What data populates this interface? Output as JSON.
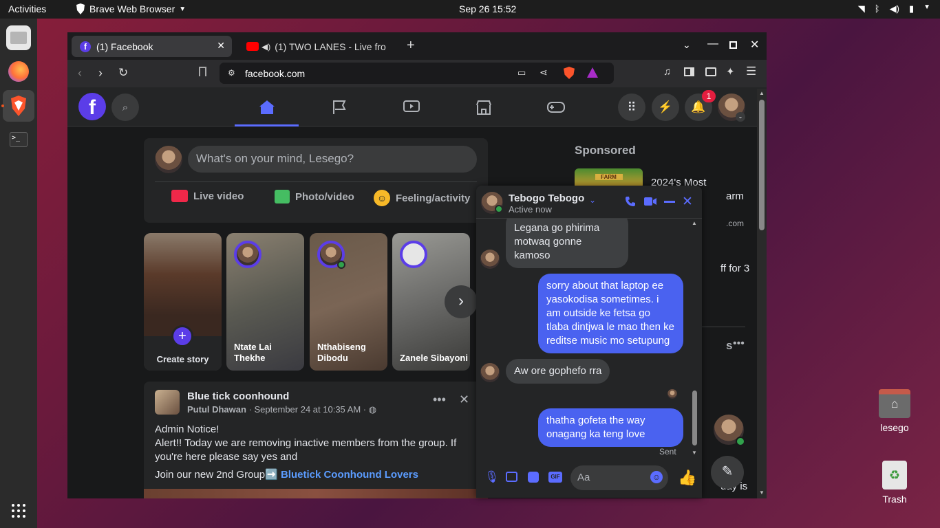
{
  "system": {
    "activities": "Activities",
    "app_name": "Brave Web Browser",
    "clock": "Sep 26  15:52"
  },
  "desktop": {
    "home_label": "lesego",
    "trash_label": "Trash"
  },
  "browser": {
    "tabs": [
      {
        "title": "(1) Facebook"
      },
      {
        "title": "(1) TWO LANES - Live fro"
      }
    ],
    "url": "facebook.com"
  },
  "fb": {
    "notification_count": "1",
    "composer_placeholder": "What's on your mind, Lesego?",
    "composer_actions": [
      {
        "label": "Live video",
        "color": "#f02849"
      },
      {
        "label": "Photo/video",
        "color": "#45bd62"
      },
      {
        "label": "Feeling/activity",
        "color": "#f7b928"
      }
    ],
    "stories": [
      {
        "name": "Create story"
      },
      {
        "name": "Ntate Lai Thekhe"
      },
      {
        "name": "Nthabiseng Dibodu"
      },
      {
        "name": "Zanele Sibayoni"
      }
    ],
    "post": {
      "group": "Blue tick coonhound",
      "author": "Putul Dhawan",
      "meta": "September 24 at 10:35 AM",
      "line1": "Admin Notice!",
      "line2": "Alert!! Today we are removing inactive members from the group. If you're here please say yes and",
      "join_prefix": "Join our new 2nd Group➡️",
      "join_link": "Bluetick Coonhound  Lovers"
    },
    "sidebar": {
      "sponsored": "Sponsored",
      "ad_title_1": "2024's Most",
      "ad_title_2": "arm",
      "ad_domain": ".com",
      "ad2": "ff for 3",
      "contacts_s": "s",
      "footer": "day is",
      "farm_label": "FARM"
    }
  },
  "chat": {
    "name": "Tebogo Tebogo",
    "status": "Active now",
    "messages": [
      {
        "dir": "in",
        "text": "Legana go phirima motwaq gonne kamoso"
      },
      {
        "dir": "out",
        "text": "sorry about that laptop ee yasokodisa sometimes. i am outside ke fetsa go tlaba dintjwa le mao then ke reditse music mo setupung"
      },
      {
        "dir": "in",
        "text": "Aw ore gophefo rra"
      },
      {
        "dir": "out",
        "text": "thatha gofeta the way onagang ka teng love"
      }
    ],
    "sent": "Sent",
    "input_placeholder": "Aa"
  }
}
